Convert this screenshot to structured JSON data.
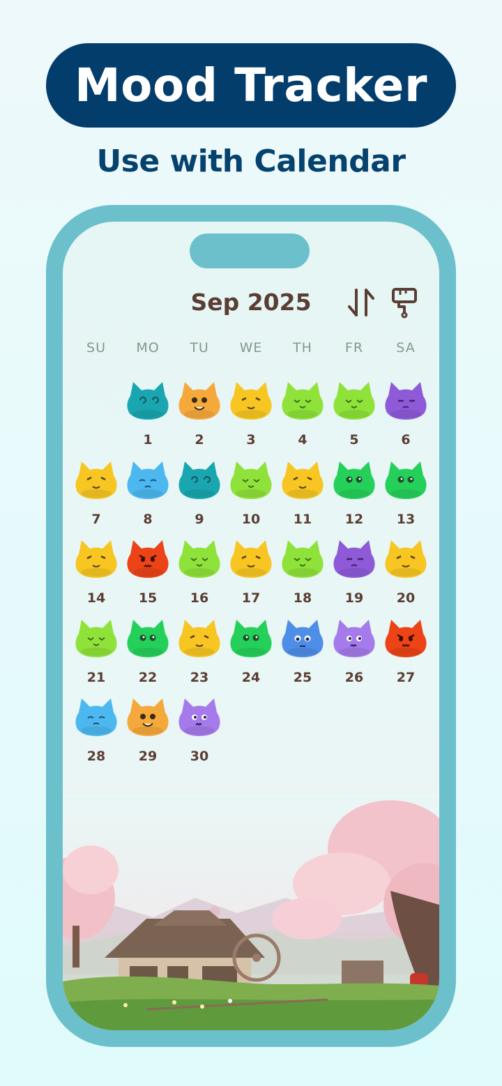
{
  "promo": {
    "title": "Mood Tracker",
    "subtitle": "Use with Calendar"
  },
  "calendar": {
    "month_label": "Sep 2025",
    "sort_icon": "sort-arrows-icon",
    "theme_icon": "paint-roller-icon",
    "weekdays": [
      "SU",
      "MO",
      "TU",
      "WE",
      "TH",
      "FR",
      "SA"
    ],
    "first_weekday_index": 1,
    "days": [
      {
        "day": "1",
        "mood": "dizzy"
      },
      {
        "day": "2",
        "mood": "laughing"
      },
      {
        "day": "3",
        "mood": "joyful"
      },
      {
        "day": "4",
        "mood": "content"
      },
      {
        "day": "5",
        "mood": "content"
      },
      {
        "day": "6",
        "mood": "troubled"
      },
      {
        "day": "7",
        "mood": "joyful"
      },
      {
        "day": "8",
        "mood": "sad"
      },
      {
        "day": "9",
        "mood": "dizzy"
      },
      {
        "day": "10",
        "mood": "content"
      },
      {
        "day": "11",
        "mood": "joyful"
      },
      {
        "day": "12",
        "mood": "calm"
      },
      {
        "day": "13",
        "mood": "calm"
      },
      {
        "day": "14",
        "mood": "joyful"
      },
      {
        "day": "15",
        "mood": "angry"
      },
      {
        "day": "16",
        "mood": "content"
      },
      {
        "day": "17",
        "mood": "joyful"
      },
      {
        "day": "18",
        "mood": "content"
      },
      {
        "day": "19",
        "mood": "troubled"
      },
      {
        "day": "20",
        "mood": "joyful"
      },
      {
        "day": "21",
        "mood": "content"
      },
      {
        "day": "22",
        "mood": "calm"
      },
      {
        "day": "23",
        "mood": "joyful"
      },
      {
        "day": "24",
        "mood": "calm"
      },
      {
        "day": "25",
        "mood": "worried"
      },
      {
        "day": "26",
        "mood": "anxious"
      },
      {
        "day": "27",
        "mood": "angry"
      },
      {
        "day": "28",
        "mood": "sad"
      },
      {
        "day": "29",
        "mood": "laughing"
      },
      {
        "day": "30",
        "mood": "anxious"
      }
    ]
  },
  "mood_colors": {
    "dizzy": "#1aa6b0",
    "laughing": "#f6a93b",
    "joyful": "#f7c623",
    "content": "#8fe23a",
    "troubled": "#8e5ad8",
    "sad": "#4cb8ef",
    "calm": "#25d05a",
    "angry": "#ec4317",
    "worried": "#4f8ee8",
    "anxious": "#a57aea"
  },
  "colors": {
    "title_bg": "#033d6b",
    "phone_frame": "#6cc0cc",
    "text_brown": "#5a3d33"
  }
}
